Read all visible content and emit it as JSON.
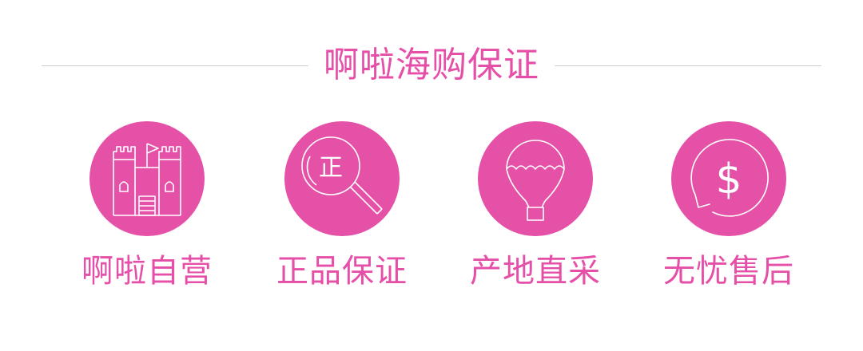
{
  "header": {
    "title": "啊啦海购保证"
  },
  "features": [
    {
      "label": "啊啦自营",
      "icon": "castle-icon"
    },
    {
      "label": "正品保证",
      "icon": "magnifier-icon",
      "icon_text": "正"
    },
    {
      "label": "产地直采",
      "icon": "hot-air-balloon-icon"
    },
    {
      "label": "无忧售后",
      "icon": "dollar-refund-icon",
      "icon_text": "$"
    }
  ],
  "colors": {
    "accent": "#e651a8",
    "divider": "#cfcfcf",
    "background": "#ffffff"
  }
}
